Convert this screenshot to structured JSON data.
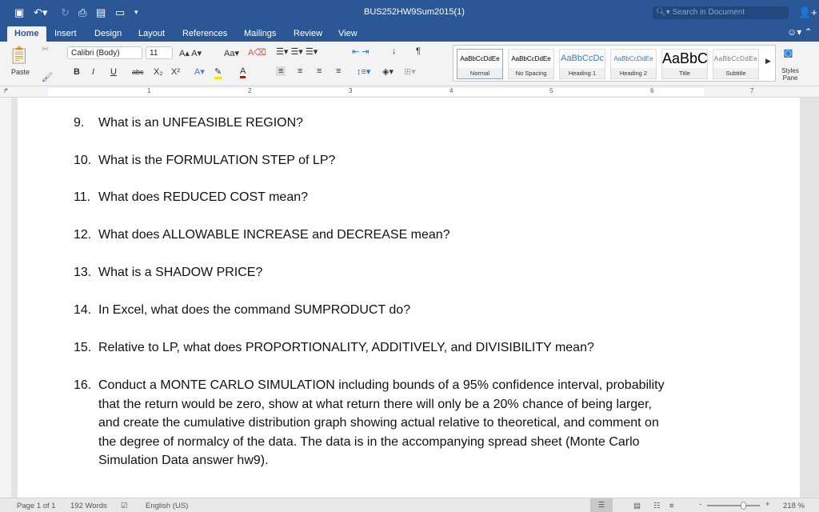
{
  "titlebar": {
    "title": "BUS252HW9Sum2015(1)",
    "search_placeholder": "Search in Document"
  },
  "tabs": [
    "Home",
    "Insert",
    "Design",
    "Layout",
    "References",
    "Mailings",
    "Review",
    "View"
  ],
  "ribbon": {
    "paste": "Paste",
    "font": "Calibri (Body)",
    "size": "11",
    "bold": "B",
    "italic": "I",
    "underline": "U",
    "strike": "abc",
    "sub": "X₂",
    "sup": "X²",
    "styles_pane": "Styles Pane",
    "styles": [
      {
        "preview": "AaBbCcDdEe",
        "label": "Normal"
      },
      {
        "preview": "AaBbCcDdEe",
        "label": "No Spacing"
      },
      {
        "preview": "AaBbCcDc",
        "label": "Heading 1"
      },
      {
        "preview": "AaBbCcDdEe",
        "label": "Heading 2"
      },
      {
        "preview": "AaBbC",
        "label": "Title"
      },
      {
        "preview": "AaBbCcDdEe",
        "label": "Subtitle"
      }
    ]
  },
  "ruler": [
    "1",
    "2",
    "3",
    "4",
    "5",
    "6",
    "7"
  ],
  "questions": [
    {
      "n": "9.",
      "t": "What is an UNFEASIBLE REGION?"
    },
    {
      "n": "10.",
      "t": "What is the FORMULATION STEP of LP?"
    },
    {
      "n": "11.",
      "t": "What does REDUCED COST mean?"
    },
    {
      "n": "12.",
      "t": "What does ALLOWABLE INCREASE and DECREASE mean?"
    },
    {
      "n": "13.",
      "t": "What is a SHADOW PRICE?"
    },
    {
      "n": "14.",
      "t": "In Excel, what does the command SUMPRODUCT do?"
    },
    {
      "n": "15.",
      "t": "Relative to LP, what does PROPORTIONALITY, ADDITIVELY, and DIVISIBILITY mean?"
    },
    {
      "n": "16.",
      "t": "Conduct a MONTE CARLO SIMULATION including bounds of a 95% confidence interval, probability that the return would be zero, show at what return there will only be a 20% chance of being larger, and create the cumulative distribution graph showing actual relative to theoretical, and comment on the degree of normalcy of the data. The data is in the accompanying spread sheet (Monte Carlo Simulation Data answer hw9)."
    }
  ],
  "status": {
    "page": "Page 1 of 1",
    "words": "192 Words",
    "language": "English (US)",
    "zoom": "218 %",
    "zoom_level": 218
  }
}
